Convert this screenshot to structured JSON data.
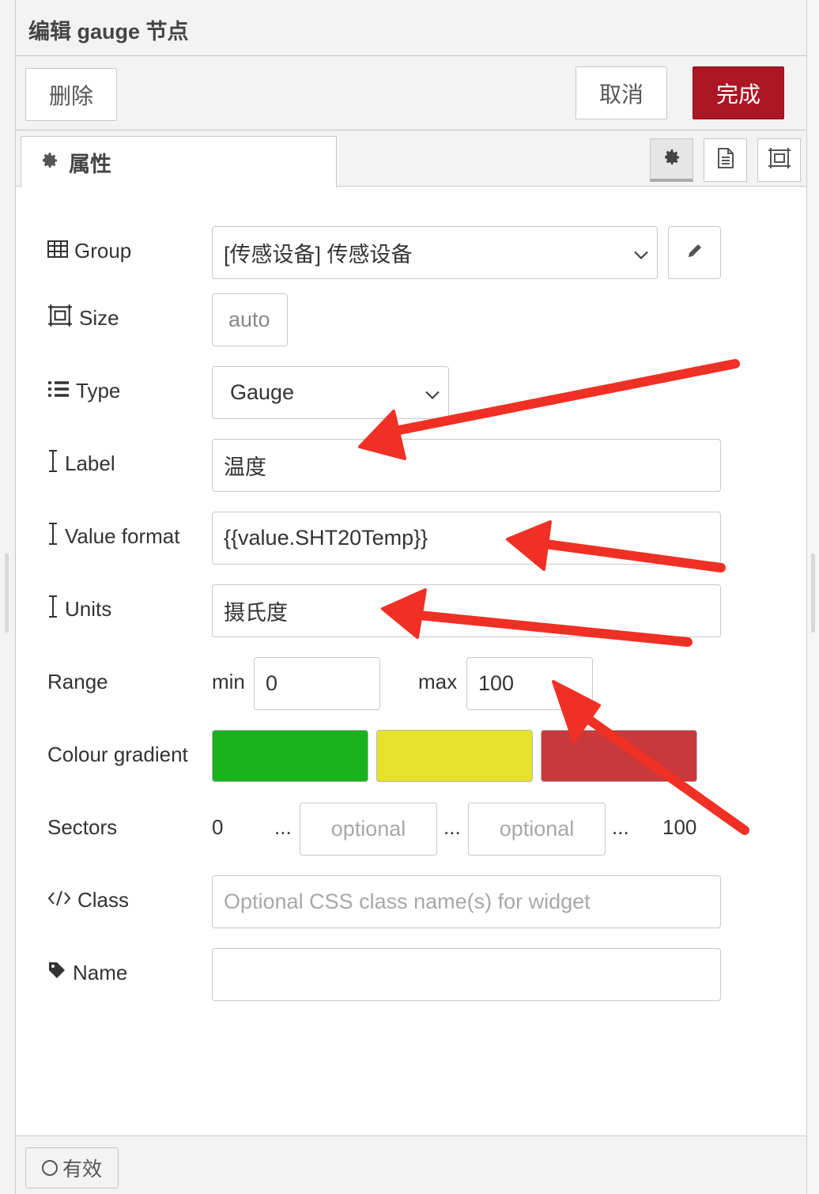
{
  "dialog": {
    "title": "编辑 gauge 节点"
  },
  "toolbar": {
    "delete_label": "删除",
    "cancel_label": "取消",
    "done_label": "完成"
  },
  "tabs": {
    "properties_label": "属性"
  },
  "form": {
    "group": {
      "label": "Group",
      "value": "[传感设备] 传感设备"
    },
    "size": {
      "label": "Size",
      "value": "auto"
    },
    "type": {
      "label": "Type",
      "value": "Gauge"
    },
    "label_field": {
      "label": "Label",
      "value": "温度"
    },
    "value_format": {
      "label": "Value format",
      "value": "{{value.SHT20Temp}}"
    },
    "units": {
      "label": "Units",
      "value": "摄氏度"
    },
    "range": {
      "label": "Range",
      "min_label": "min",
      "min_value": "0",
      "max_label": "max",
      "max_value": "100"
    },
    "colour_gradient": {
      "label": "Colour gradient",
      "colors": [
        "#1bb21f",
        "#e6e22c",
        "#c9383a"
      ]
    },
    "sectors": {
      "label": "Sectors",
      "start": "0",
      "sep1": "...",
      "placeholder1": "optional",
      "sep2": "...",
      "placeholder2": "optional",
      "sep3": "...",
      "end": "100"
    },
    "class": {
      "label": "Class",
      "placeholder": "Optional CSS class name(s) for widget"
    },
    "name": {
      "label": "Name",
      "value": ""
    }
  },
  "footer": {
    "enabled_label": "有效"
  },
  "colors": {
    "accent": "#ad1625",
    "annotation_arrow": "#f03024"
  }
}
